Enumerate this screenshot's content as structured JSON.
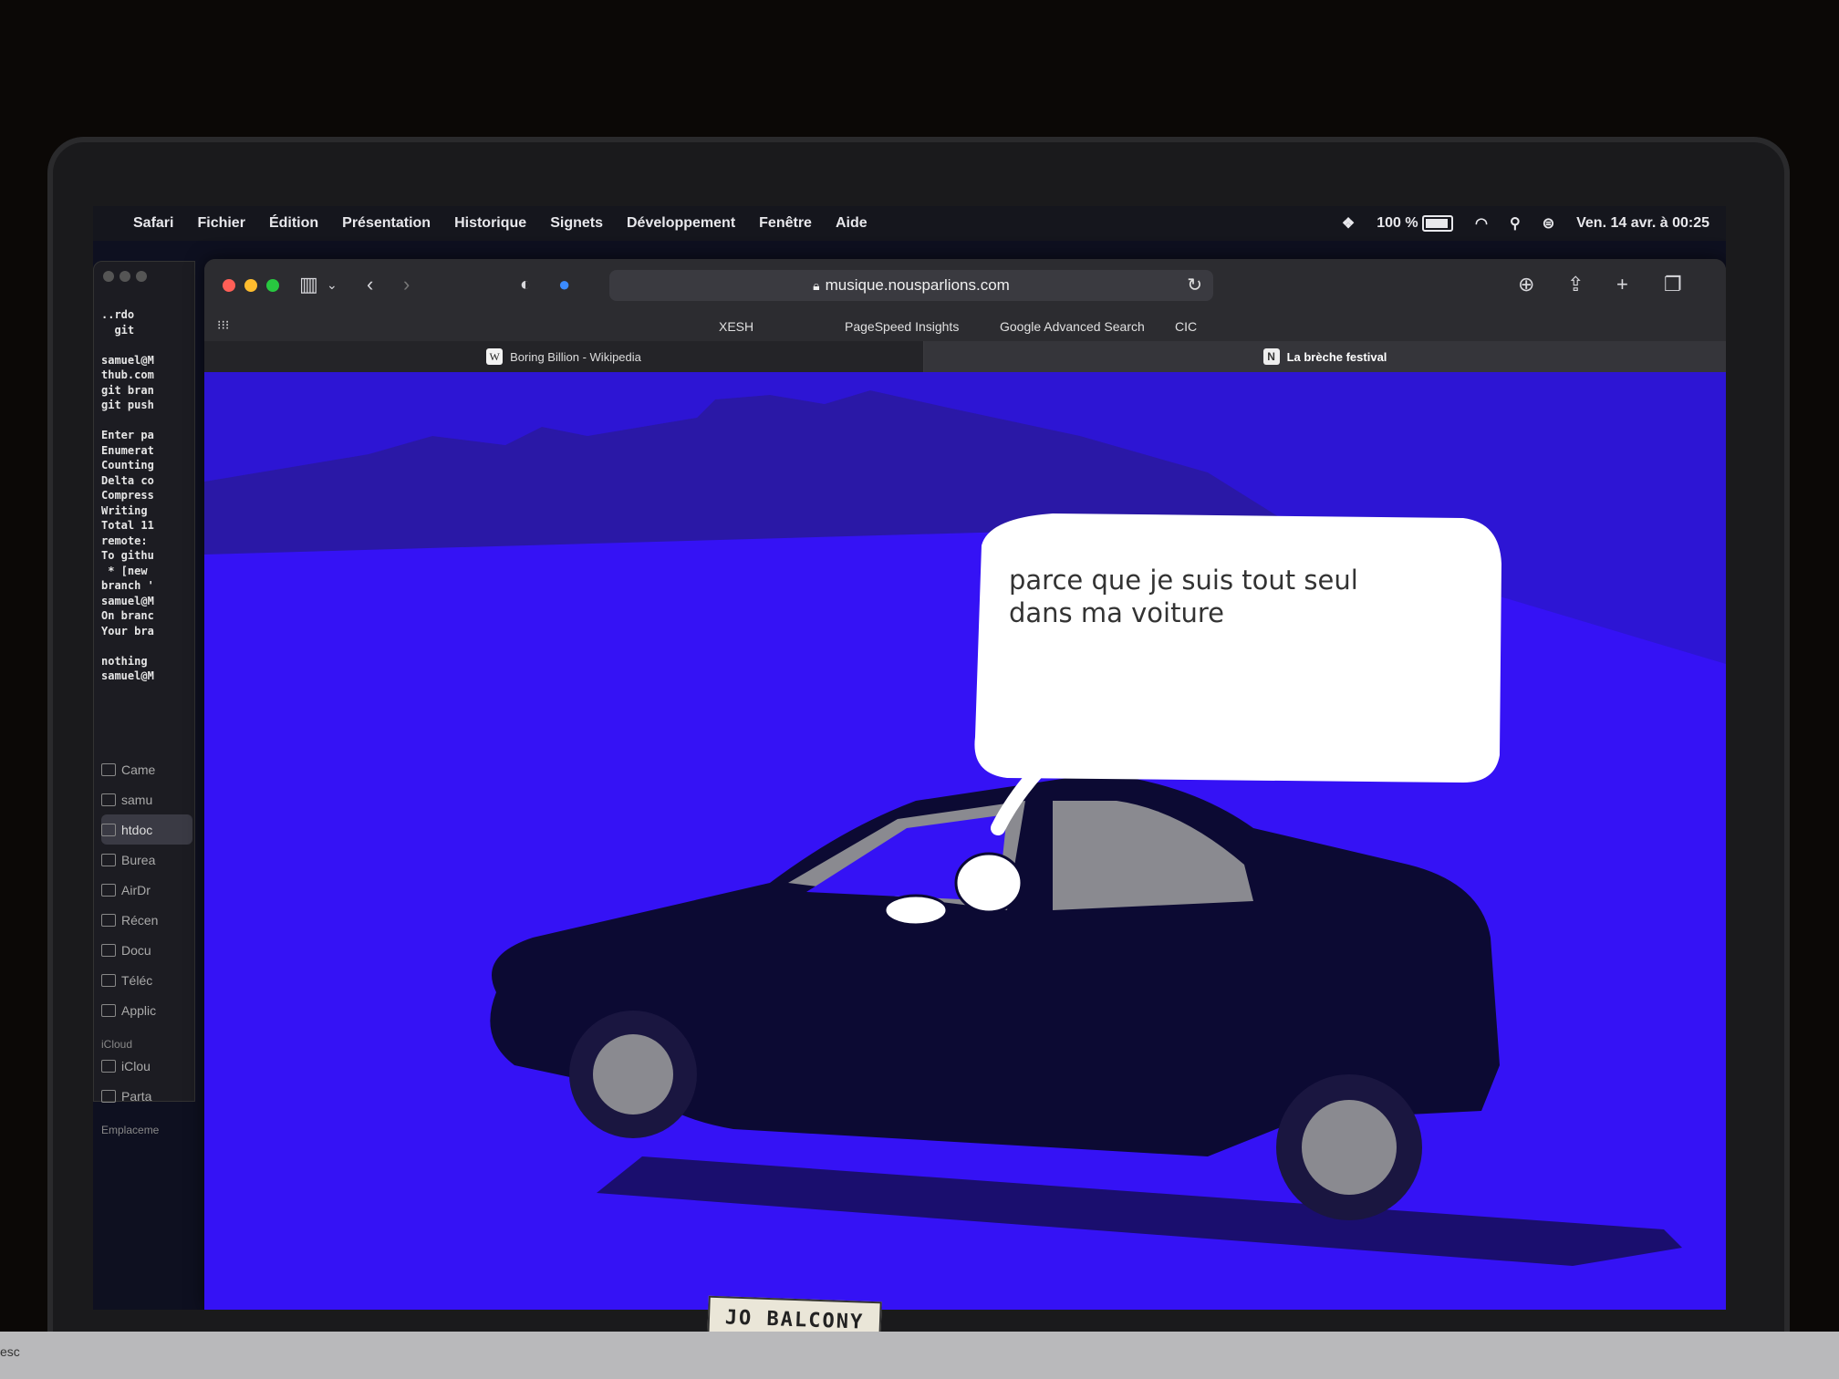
{
  "menubar": {
    "apple": "",
    "items": [
      "Safari",
      "Fichier",
      "Édition",
      "Présentation",
      "Historique",
      "Signets",
      "Développement",
      "Fenêtre",
      "Aide"
    ],
    "battery": "100 %",
    "datetime": "Ven. 14 avr. à 00:25"
  },
  "terminal": {
    "lines": "..rdo\n  git\n\nsamuel@M\nthub.com\ngit bran\ngit push\n\nEnter pa\nEnumerat\nCounting\nDelta co\nCompress\nWriting\nTotal 11\nremote:\nTo githu\n * [new\nbranch '\nsamuel@M\nOn branc\nYour bra\n\nnothing\nsamuel@M"
  },
  "finder": {
    "items": [
      "Came",
      "samu",
      "htdoc",
      "Burea",
      "AirDr",
      "Récen",
      "Docu",
      "Téléc",
      "Applic"
    ],
    "icloud_section": "iCloud",
    "icloud_items": [
      "iClou",
      "Parta"
    ],
    "footer": "Emplaceme"
  },
  "safari": {
    "address": "musique.nousparlions.com",
    "favorites": [
      "XESH",
      "PageSpeed Insights",
      "Google Advanced Search",
      "CIC"
    ],
    "tabs": [
      {
        "label": "Boring Billion - Wikipedia",
        "favicon": "W"
      },
      {
        "label": "La brèche festival",
        "favicon": "N"
      }
    ]
  },
  "page": {
    "speech_line1": "parce que je suis tout seul",
    "speech_line2": "dans ma voiture"
  },
  "sticker": "JO BALCONY",
  "keyboard": {
    "esc": "esc"
  },
  "colors": {
    "page_bg": "#3512f5",
    "car": "#0c0a33",
    "window_gray": "#8a8a90"
  }
}
